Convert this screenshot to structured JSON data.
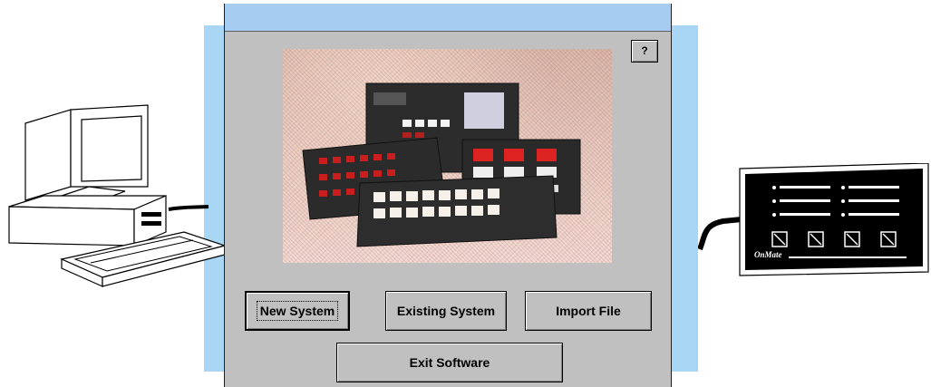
{
  "dialog": {
    "help_label": "?"
  },
  "buttons": {
    "new_system": "New System",
    "existing_system": "Existing System",
    "import_file": "Import File",
    "exit_software": "Exit Software"
  },
  "keypad": {
    "brand_label": "OnMate"
  },
  "colors": {
    "backdrop": "#a9d6f5",
    "titlebar": "#a6ccf2",
    "dialog_face": "#c0c0c0"
  }
}
